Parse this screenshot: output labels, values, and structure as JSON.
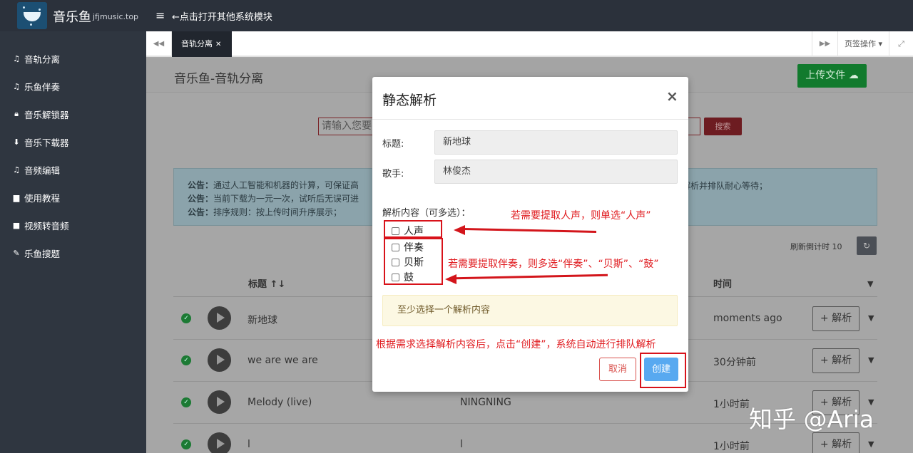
{
  "header": {
    "app_name": "音乐鱼",
    "app_domain": "jfjmusic.top",
    "menu_hint": "←点击打开其他系统模块"
  },
  "sidebar": {
    "items": [
      {
        "label": "音轨分离",
        "icon": "music-note-icon"
      },
      {
        "label": "乐鱼伴奏",
        "icon": "music-note-icon"
      },
      {
        "label": "音乐解锁器",
        "icon": "lock-icon"
      },
      {
        "label": "音乐下载器",
        "icon": "download-icon"
      },
      {
        "label": "音频编辑",
        "icon": "music-note-icon"
      },
      {
        "label": "使用教程",
        "icon": "book-icon"
      },
      {
        "label": "视频转音频",
        "icon": "video-camera-icon"
      },
      {
        "label": "乐鱼搜题",
        "icon": "pencil-icon"
      }
    ]
  },
  "tabs": {
    "active": "音轨分离",
    "ops_label": "页签操作"
  },
  "main": {
    "page_title": "音乐鱼-音轨分离",
    "upload_label": "上传文件",
    "search_placeholder": "请输入您要",
    "search_button": "搜索",
    "notices": [
      {
        "label": "公告：",
        "text": "通过人工智能和机器的计算，可保证高"
      },
      {
        "label": "公告：",
        "text": "当前下载为一元一次，试听后无误可进"
      },
      {
        "label": "公告：",
        "text": "排序规则：按上传时间升序展示；"
      }
    ],
    "notice_right": "解析并排队耐心等待；",
    "refresh_label": "刷新倒计时",
    "refresh_count": "10",
    "columns": {
      "title": "标题",
      "time": "时间"
    },
    "rows": [
      {
        "title": "新地球",
        "artist": "",
        "time": "moments ago",
        "action": "+ 解析"
      },
      {
        "title": "we are we are",
        "artist": "",
        "time": "30分钟前",
        "action": "+ 解析"
      },
      {
        "title": "Melody (live)",
        "artist": "NINGNING",
        "time": "1小时前",
        "action": "+ 解析"
      },
      {
        "title": "l",
        "artist": "l",
        "time": "1小时前",
        "action": "+ 解析"
      }
    ]
  },
  "modal": {
    "title": "静态解析",
    "fields": [
      {
        "label": "标题:",
        "value": "新地球"
      },
      {
        "label": "歌手:",
        "value": "林俊杰"
      }
    ],
    "section_label": "解析内容（可多选）：",
    "options": [
      "人声",
      "伴奏",
      "贝斯",
      "鼓"
    ],
    "warning": "至少选择一个解析内容",
    "cancel_label": "取消",
    "create_label": "创建"
  },
  "annotations": {
    "vocal": "若需要提取人声，则单选“人声”",
    "accompaniment": "若需要提取伴奏，则多选“伴奏”、“贝斯”、“鼓”",
    "create": "根据需求选择解析内容后，点击“创建”，系统自动进行排队解析"
  },
  "watermark": "知乎 @Aria",
  "colors": {
    "topbar": "#2b313b",
    "sidebar": "#2f3640",
    "upload": "#117a2d",
    "annotation": "#e01c20",
    "create": "#58a9f0",
    "cancel": "#d9534f"
  }
}
